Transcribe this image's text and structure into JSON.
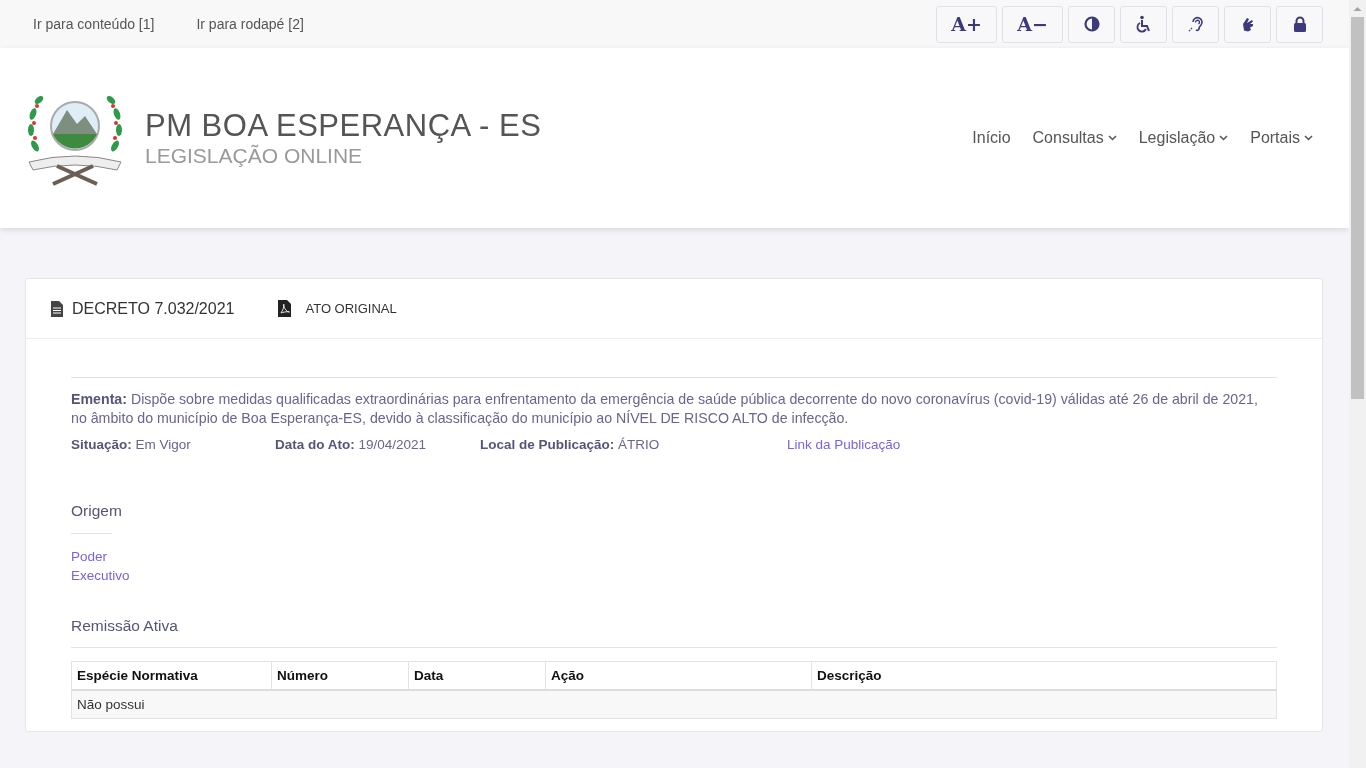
{
  "skip_links": [
    "Ir para conteúdo [1]",
    "Ir para rodapé [2]"
  ],
  "accessibility_buttons": [
    {
      "kind": "text",
      "label": "A+"
    },
    {
      "kind": "text",
      "label": "A−"
    },
    {
      "kind": "contrast"
    },
    {
      "kind": "wheelchair"
    },
    {
      "kind": "hearing"
    },
    {
      "kind": "sign-language"
    },
    {
      "kind": "lock"
    }
  ],
  "site": {
    "title": "PM BOA ESPERANÇA - ES",
    "subtitle": "LEGISLAÇÃO ONLINE"
  },
  "nav": [
    {
      "label": "Início",
      "dropdown": false
    },
    {
      "label": "Consultas",
      "dropdown": true
    },
    {
      "label": "Legislação",
      "dropdown": true
    },
    {
      "label": "Portais",
      "dropdown": true
    }
  ],
  "card": {
    "title": "DECRETO 7.032/2021",
    "original_link": "ATO ORIGINAL",
    "ementa": "**Ementa:** Dispõe sobre medidas qualificadas extraordinárias para enfrentamento da emergência de saúde pública decorrente do novo coronavírus (covid-19) válidas até 26 de abril de 2021, no âmbito do município de Boa Esperança-ES, devido à classificação do município ao NÍVEL DE RISCO ALTO de infecção.",
    "details": [
      {
        "kind": "field",
        "text": "**Situação:** Em Vigor"
      },
      {
        "kind": "field",
        "text": "**Data do Ato:** 19/04/2021"
      },
      {
        "kind": "field",
        "text": "**Local de Publicação:** ÁTRIO"
      },
      {
        "kind": "link",
        "text": "Link da Publicação"
      }
    ],
    "origem": {
      "heading": "Origem",
      "lines": [
        "Poder",
        "Executivo"
      ]
    },
    "remissao": {
      "heading": "Remissão Ativa",
      "columns": [
        "Espécie Normativa",
        "Número",
        "Data",
        "Ação",
        "Descrição"
      ],
      "empty_text": "Não possui"
    }
  }
}
